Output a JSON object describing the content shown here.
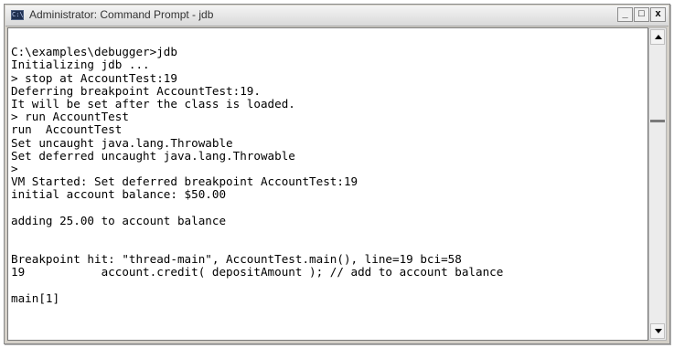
{
  "window": {
    "title": "Administrator: Command Prompt - jdb",
    "icon": "cmd-icon",
    "controls": {
      "minimize": "_",
      "maximize": "□",
      "close": "x"
    }
  },
  "console": {
    "lines": [
      "",
      "C:\\examples\\debugger>jdb",
      "Initializing jdb ...",
      "> stop at AccountTest:19",
      "Deferring breakpoint AccountTest:19.",
      "It will be set after the class is loaded.",
      "> run AccountTest",
      "run  AccountTest",
      "Set uncaught java.lang.Throwable",
      "Set deferred uncaught java.lang.Throwable",
      ">",
      "VM Started: Set deferred breakpoint AccountTest:19",
      "initial account balance: $50.00",
      "",
      "adding 25.00 to account balance",
      "",
      "",
      "Breakpoint hit: \"thread-main\", AccountTest.main(), line=19 bci=58",
      "19           account.credit( depositAmount ); // add to account balance",
      "",
      "main[1]"
    ]
  },
  "scrollbar": {
    "position": 0.27
  }
}
